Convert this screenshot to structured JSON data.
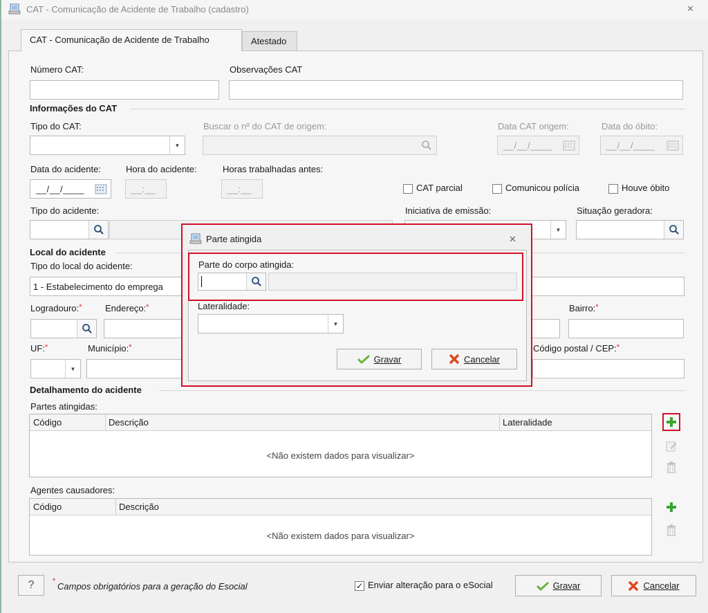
{
  "window": {
    "title": "CAT - Comunicação de Acidente de Trabalho (cadastro)"
  },
  "tabs": [
    {
      "label": "CAT - Comunicação de Acidente de Trabalho",
      "active": true
    },
    {
      "label": "Atestado",
      "active": false
    }
  ],
  "form": {
    "numero_cat": {
      "label": "Número CAT:",
      "value": ""
    },
    "observacoes": {
      "label": "Observações CAT",
      "value": ""
    },
    "section_info": "Informações do CAT",
    "tipo_cat": {
      "label": "Tipo do CAT:",
      "value": ""
    },
    "buscar_cat": {
      "label": "Buscar o nº do CAT de origem:",
      "value": ""
    },
    "data_cat_origem": {
      "label": "Data CAT origem:",
      "mask": "__/__/____"
    },
    "data_obito": {
      "label": "Data do óbito:",
      "mask": "__/__/____"
    },
    "data_acidente": {
      "label": "Data do acidente:",
      "mask": "__/__/____"
    },
    "hora_acidente": {
      "label": "Hora do acidente:",
      "mask": "__:__"
    },
    "horas_trabalhadas": {
      "label": "Horas trabalhadas antes:",
      "mask": "__:__"
    },
    "cat_parcial": {
      "label": "CAT parcial",
      "checked": false
    },
    "comunicou_policia": {
      "label": "Comunicou polícia",
      "checked": false
    },
    "houve_obito": {
      "label": "Houve óbito",
      "checked": false
    },
    "tipo_acidente": {
      "label": "Tipo do acidente:"
    },
    "iniciativa": {
      "label": "Iniciativa de emissão:"
    },
    "situacao": {
      "label": "Situação geradora:"
    },
    "section_local": "Local do acidente",
    "tipo_local": {
      "label": "Tipo do local do acidente:",
      "value": "1 - Estabelecimento do emprega"
    },
    "logradouro": {
      "label": "Logradouro:"
    },
    "endereco": {
      "label": "Endereço:"
    },
    "bairro": {
      "label": "Bairro:"
    },
    "uf": {
      "label": "UF:"
    },
    "municipio": {
      "label": "Município:"
    },
    "cep": {
      "label": "Código postal / CEP:"
    },
    "required_mark": "*",
    "section_detalhe": "Detalhamento do acidente",
    "partes": {
      "label": "Partes atingidas:",
      "columns": [
        "Código",
        "Descrição",
        "Lateralidade"
      ],
      "empty": "<Não existem dados para visualizar>"
    },
    "agentes": {
      "label": "Agentes causadores:",
      "columns": [
        "Código",
        "Descrição"
      ],
      "empty": "<Não existem dados para visualizar>"
    }
  },
  "footer": {
    "help": "?",
    "note": "Campos obrigatórios para a geração do Esocial",
    "enviar": {
      "label": "Enviar alteração para o eSocial",
      "checked": true
    },
    "gravar": "Gravar",
    "cancelar": "Cancelar"
  },
  "modal": {
    "title": "Parte atingida",
    "parte_label": "Parte do corpo atingida:",
    "lateralidade_label": "Lateralidade:",
    "gravar": "Gravar",
    "cancelar": "Cancelar"
  },
  "colors": {
    "highlight": "#d0102a",
    "accent_green": "#3aa52e",
    "cancel_red": "#e0461e"
  }
}
